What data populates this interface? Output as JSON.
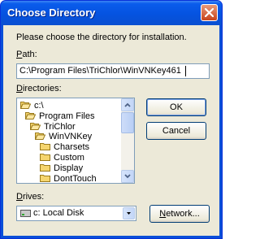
{
  "window": {
    "title": "Choose Directory"
  },
  "dialog": {
    "prompt": "Please choose the directory for installation.",
    "path_label": "Path:",
    "path_value": "C:\\Program Files\\TriChlor\\WinVNKey461",
    "directories_label": "Directories:",
    "directories": [
      {
        "name": "c:\\",
        "level": 0,
        "icon": "open-folder-icon"
      },
      {
        "name": "Program Files",
        "level": 1,
        "icon": "open-folder-icon"
      },
      {
        "name": "TriChlor",
        "level": 2,
        "icon": "open-folder-icon"
      },
      {
        "name": "WinVNKey",
        "level": 3,
        "icon": "open-folder-icon"
      },
      {
        "name": "Charsets",
        "level": 4,
        "icon": "folder-icon"
      },
      {
        "name": "Custom",
        "level": 4,
        "icon": "folder-icon"
      },
      {
        "name": "Display",
        "level": 4,
        "icon": "folder-icon"
      },
      {
        "name": "DontTouch",
        "level": 4,
        "icon": "folder-icon"
      }
    ],
    "ok_label": "OK",
    "cancel_label": "Cancel",
    "drives_label": "Drives:",
    "drive_value": "c: Local Disk",
    "network_label": "Network..."
  },
  "colors": {
    "titlebar": "#0a5cec",
    "dialog_bg": "#ece9d8",
    "folder": "#f5d56e"
  }
}
